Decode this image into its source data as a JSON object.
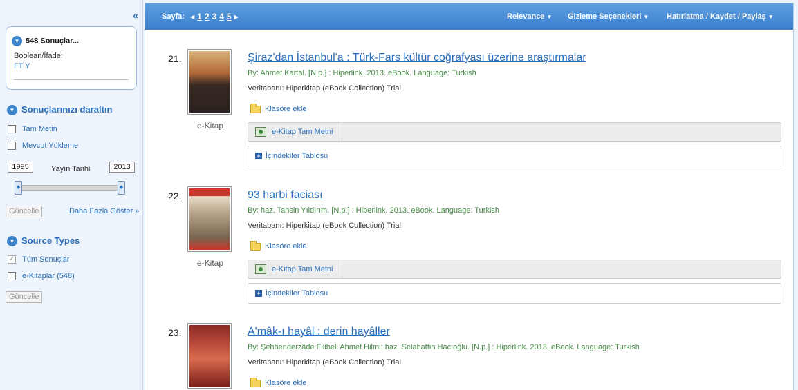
{
  "sidebar": {
    "collapse": "«",
    "summary": {
      "title": "548 Sonuçlar...",
      "boolean_label": "Boolean/İfade:",
      "query": "FT Y"
    },
    "refine": {
      "heading": "Sonuçlarınızı daraltın",
      "full_text": "Tam Metin",
      "available": "Mevcut Yükleme",
      "year_from": "1995",
      "year_to": "2013",
      "year_label": "Yayın Tarihi",
      "update": "Güncelle",
      "more": "Daha Fazla Göster »"
    },
    "source_types": {
      "heading": "Source Types",
      "all": "Tüm Sonuçlar",
      "ebooks": "e-Kitaplar (548)",
      "update": "Güncelle"
    }
  },
  "topbar": {
    "page_label": "Sayfa:",
    "pages": [
      "1",
      "2",
      "3",
      "4",
      "5"
    ],
    "relevance": "Relevance",
    "display_options": "Gizleme Seçenekleri",
    "share": "Hatırlatma / Kaydet / Paylaş"
  },
  "results": [
    {
      "num": "21.",
      "title": "Şiraz'dan İstanbul'a : Türk-Fars kültür coğrafyası üzerine araştırmalar",
      "meta": "By: Ahmet Kartal. [N.p.] : Hiperlink. 2013. eBook. Language: Turkish",
      "db": "Veritabanı: Hiperkitap (eBook Collection) Trial",
      "type": "e-Kitap",
      "folder": "Klasöre ekle",
      "fulltext": "e-Kitap Tam Metni",
      "toc": "İçindekiler Tablosu"
    },
    {
      "num": "22.",
      "title": "93 harbi faciası",
      "meta": "By: haz. Tahsin Yıldırım. [N.p.] : Hiperlink. 2013. eBook. Language: Turkish",
      "db": "Veritabanı: Hiperkitap (eBook Collection) Trial",
      "type": "e-Kitap",
      "folder": "Klasöre ekle",
      "fulltext": "e-Kitap Tam Metni",
      "toc": "İçindekiler Tablosu"
    },
    {
      "num": "23.",
      "title": "A'mâk-ı hayâl : derin hayâller",
      "meta": "By: Şehbenderzâde Filibeli Ahmet Hilmi; haz. Selahattin Hacıoğlu. [N.p.] : Hiperlink. 2013. eBook. Language: Turkish",
      "db": "Veritabanı: Hiperkitap (eBook Collection) Trial",
      "folder": "Klasöre ekle"
    }
  ]
}
